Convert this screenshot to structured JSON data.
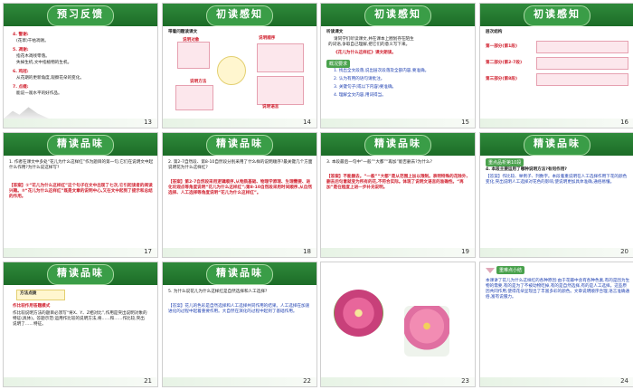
{
  "slides": [
    {
      "title": "预习反馈",
      "num": "13",
      "badge": "",
      "lines": [
        "4. 警谢:",
        "(花草)干枯凋谢。",
        "5. 凋谢:",
        "指花木凋残零落。",
        "失掉生机,文中指植物的生机。",
        "6. 鸡冠:",
        "从花期的更新角度,观察花朵的变化。",
        "7. 点缀:",
        "能说一观水平的好作品。"
      ]
    },
    {
      "title": "初读感知",
      "num": "14",
      "badge": "",
      "lines": [
        "带着问题读课文",
        "说明对象",
        "说明顺序",
        "说明方法",
        "说明语言"
      ]
    },
    {
      "title": "初读感知",
      "num": "15",
      "badge": "",
      "lines": [
        "听读课文",
        "请同学们听读课文,并在课本上圈划存在陌生",
        "的词语,争取自己理解,把它们的意义写下来。",
        "《花儿为什么这样红》课文朗读。",
        "概况要求",
        "1. 找出全文段落,说出层次段落及全部内容,要准确。",
        "2. 认为有用的语句请批注。",
        "3. 关键句子(或以下内容)要准确。",
        "4. 理解全文内容,用词得当。"
      ]
    },
    {
      "title": "初读感知",
      "num": "16",
      "badge": "",
      "lines": [
        "层次结构",
        "第一部分(第1段)",
        "第二部分(第2-7段)",
        "第三部分(第8段)"
      ]
    },
    {
      "title": "精读品味",
      "num": "17",
      "badge": "",
      "lines": [
        "1. 作者在课文中多处“花儿为什么这样红”作为题目的第一句,它们在说明文中起什么作用?为什么说这样写?",
        "【答案】①“花儿为什么这样红”这个句子在文中出现了七次,它引起读者的阅读兴趣。②“花儿为什么这样红”既是文章的说明中心,又在文中起到了提示和总结的作用。"
      ]
    },
    {
      "title": "精读品味",
      "num": "18",
      "badge": "",
      "lines": [
        "2. 第2-7自然段、第8-10自然段分别采用了什么样的说明顺序?最关键几个方面说明花为什么这样红?",
        "【答案】第2-7自然段采用逻辑顺序,从物质基础、物理学原理、生理需要、进化论观点等角度说明“花儿为什么这样红”;第8-10自然段采用时间顺序,从自然选择、人工选择等角度说明“花儿为什么这样红”。"
      ]
    },
    {
      "title": "精读品味",
      "num": "19",
      "badge": "",
      "lines": [
        "3. 本段最后一句中“一般”“大都”“再加”能否删去?为什么?",
        "【答案】不能删去。“一般”“大都”是从范围上加以限制。表明特殊的花除外,删去后句意就变为所有的花,不符合实际。体现了说明文语言的准确性。“再加”是在程度上进一步补充说明。"
      ]
    },
    {
      "title": "精读品味",
      "num": "20",
      "badge": "",
      "lines": [
        "重点品析第10段",
        "4. 本段主要运用了哪种说明方法?有何作用?",
        "【答案】作比较、举例子、列数字。本段着重说明在人工选择作用下花的颜色变化,突出说明人工选择对花色的影响,使说明更加具体准确,通俗易懂。"
      ]
    },
    {
      "title": "精读品味",
      "num": "21",
      "badge": "",
      "lines": [
        "方法点拨",
        "作比较作用答题模式",
        "作比较说明方法的题目必须写“将X、Y、Z相对比”,作用是突出说明对象的特征(具体)。答题示范:运用作比较的说明方法,将……和……作比较,突出说明了……特征。"
      ]
    },
    {
      "title": "精读品味",
      "num": "22",
      "badge": "",
      "lines": [
        "5. 为什么说花儿为什么这样红是自然选择和人工选择?",
        "【答案】花儿的色彩是自然选择和人工选择共同作用的结果。人工选择在加速进化的过程中起着重要作用。大自然在演化的过程中起到了基础作用。"
      ]
    },
    {
      "title": "",
      "num": "23",
      "badge": "",
      "lines": []
    },
    {
      "title": "",
      "num": "24",
      "badge": "",
      "lines": [
        "重难点小结",
        "本课讲了花儿为什么这样红的各种原因:由于花瓣中含有各种色素,有的是因为生物的需要,有的是为了不被动物吃掉,有的是自然选择,有的是人工选择。这些原因共同作用,使得花朵呈现出了丰富多彩的颜色。文章说明顺序合理,语言准确通俗,富有说服力。"
      ]
    }
  ],
  "footer_text": "阅读文本 精读品味",
  "colors": {
    "head": "#1c6c27",
    "answer": "#d0202e",
    "accent": "#4aa24d"
  }
}
